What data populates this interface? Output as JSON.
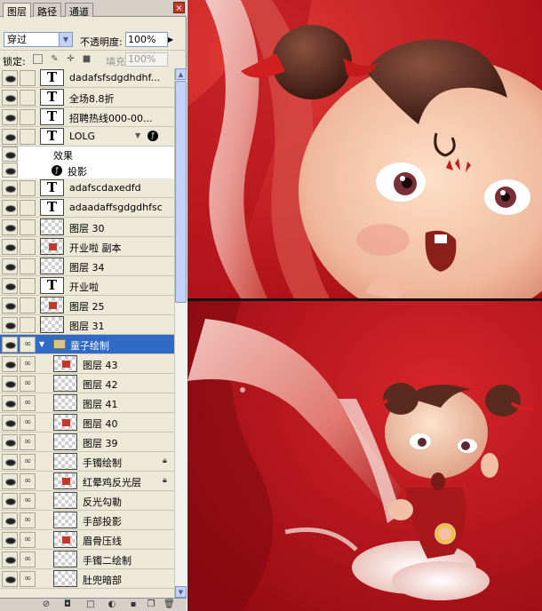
{
  "tabs": {
    "layers": "图层",
    "paths": "路径",
    "channels": "通道",
    "close": "×"
  },
  "blend": {
    "mode": "穿过",
    "opacity_label": "不透明度:",
    "opacity_value": "100%"
  },
  "lock": {
    "label": "锁定:",
    "fill_label": "填充:",
    "fill_value": "100%"
  },
  "layers": [
    {
      "name": "dadafsfsdgdhdhf...",
      "kind": "text"
    },
    {
      "name": "全场8.8折",
      "kind": "text"
    },
    {
      "name": "招聘热线000-00...",
      "kind": "text"
    },
    {
      "name": "LOLG",
      "kind": "text",
      "has_fx": true
    },
    {
      "name": "效果",
      "kind": "effect-header"
    },
    {
      "name": "投影",
      "kind": "effect"
    },
    {
      "name": "adafscdaxedfd",
      "kind": "text"
    },
    {
      "name": "adaadaffsgdgdhfsc",
      "kind": "text"
    },
    {
      "name": "图层 30",
      "kind": "raster"
    },
    {
      "name": "开业啦 副本",
      "kind": "raster"
    },
    {
      "name": "图层 34",
      "kind": "raster"
    },
    {
      "name": "开业啦",
      "kind": "text"
    },
    {
      "name": "图层 25",
      "kind": "raster"
    },
    {
      "name": "图层 31",
      "kind": "raster"
    },
    {
      "name": "童子绘制",
      "kind": "group",
      "selected": true
    },
    {
      "name": "图层 43",
      "kind": "raster",
      "indent": true
    },
    {
      "name": "图层 42",
      "kind": "raster",
      "indent": true
    },
    {
      "name": "图层 41",
      "kind": "raster",
      "indent": true
    },
    {
      "name": "图层 40",
      "kind": "raster",
      "indent": true
    },
    {
      "name": "图层 39",
      "kind": "raster",
      "indent": true
    },
    {
      "name": "手镯绘制",
      "kind": "raster",
      "indent": true,
      "locked": true
    },
    {
      "name": "红晕鸡反光层",
      "kind": "raster",
      "indent": true,
      "locked": true
    },
    {
      "name": "反光勾勒",
      "kind": "raster",
      "indent": true
    },
    {
      "name": "手部投影",
      "kind": "raster",
      "indent": true
    },
    {
      "name": "眉骨压线",
      "kind": "raster",
      "indent": true
    },
    {
      "name": "手镯二绘制",
      "kind": "raster",
      "indent": true
    },
    {
      "name": "肚兜暗部",
      "kind": "raster",
      "indent": true
    }
  ],
  "icons": {
    "visibility": "eye-icon",
    "link": "chain-link-icon",
    "fx": "fx-badge-icon",
    "lock": "padlock-icon",
    "bottom": [
      "link-layers-icon",
      "layer-style-icon",
      "layer-mask-icon",
      "new-group-icon",
      "adjustment-layer-icon",
      "new-layer-icon",
      "trash-icon"
    ]
  },
  "colors": {
    "selection": "#316ac5",
    "panel": "#ece9d8",
    "artwork_red": "#c4121a"
  }
}
